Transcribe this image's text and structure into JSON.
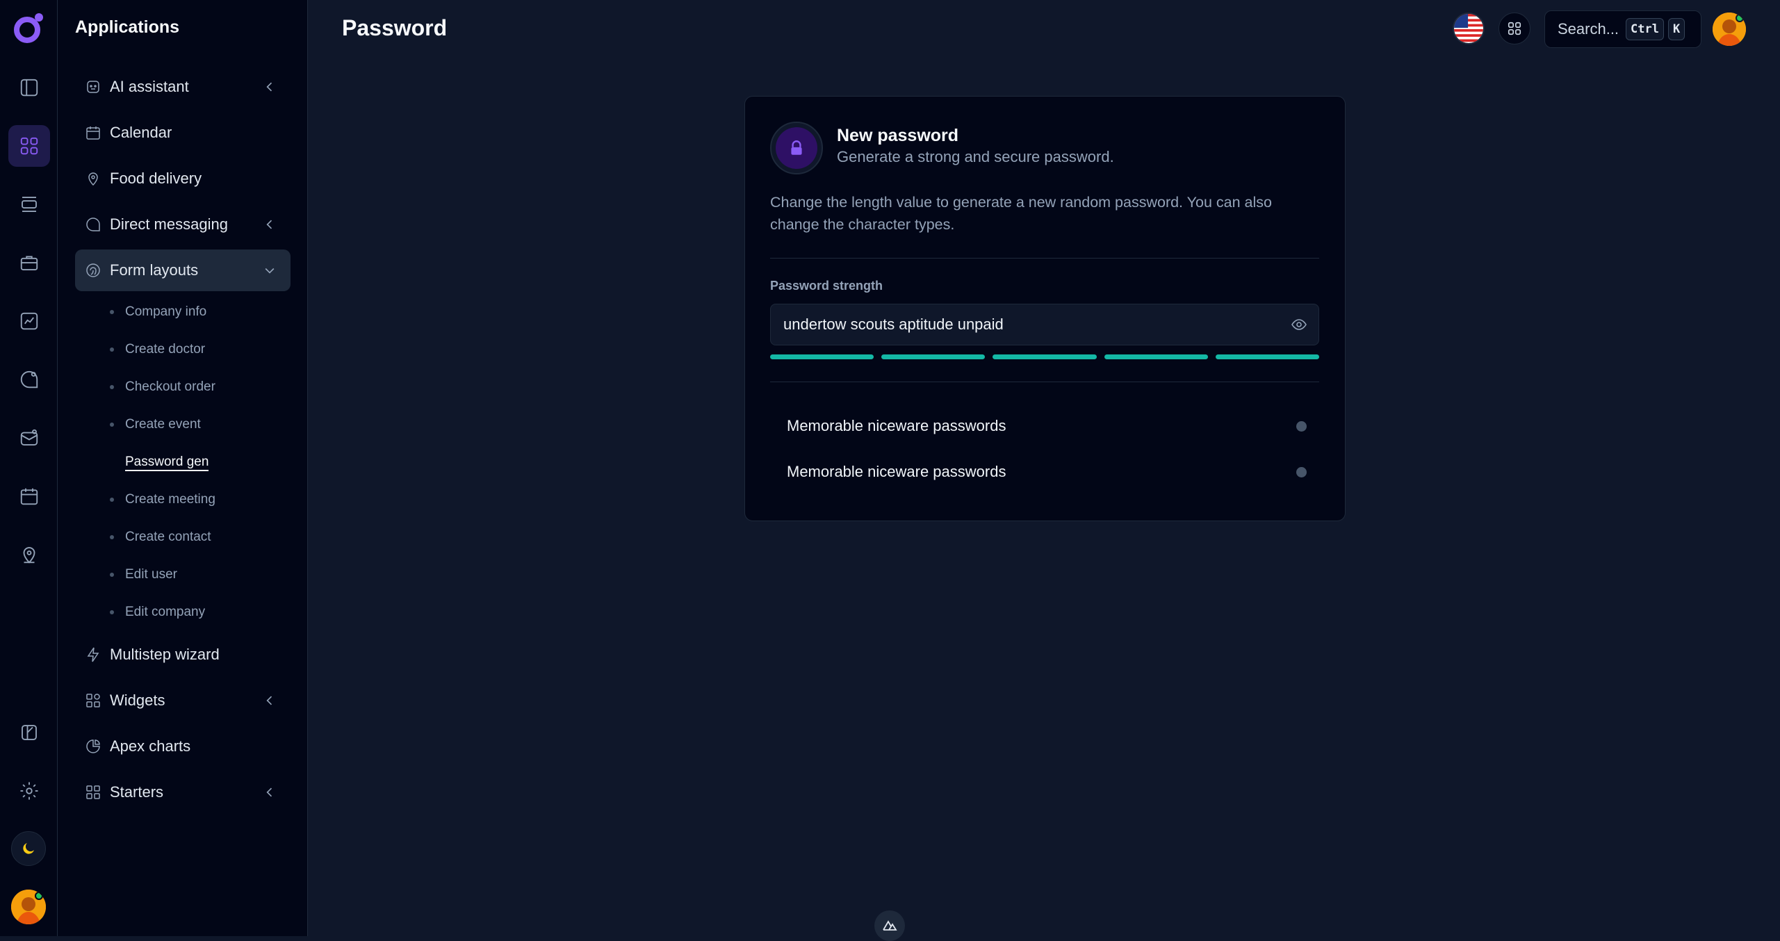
{
  "sidebar": {
    "title": "Applications",
    "items": [
      {
        "label": "AI assistant"
      },
      {
        "label": "Calendar"
      },
      {
        "label": "Food delivery"
      },
      {
        "label": "Direct messaging"
      },
      {
        "label": "Form layouts"
      },
      {
        "label": "Multistep wizard"
      },
      {
        "label": "Widgets"
      },
      {
        "label": "Apex charts"
      },
      {
        "label": "Starters"
      }
    ],
    "subitems": [
      {
        "label": "Company info"
      },
      {
        "label": "Create doctor"
      },
      {
        "label": "Checkout order"
      },
      {
        "label": "Create event"
      },
      {
        "label": "Password gen"
      },
      {
        "label": "Create meeting"
      },
      {
        "label": "Create contact"
      },
      {
        "label": "Edit user"
      },
      {
        "label": "Edit company"
      }
    ],
    "active_subitem": "Password gen"
  },
  "header": {
    "title": "Password",
    "search_placeholder": "Search...",
    "shortcut": [
      "Ctrl",
      "K"
    ],
    "language_icon": "us-flag-icon"
  },
  "card": {
    "title": "New password",
    "subtitle": "Generate a strong and secure password.",
    "description": "Change the length value to generate a new random password. You can also change the character types.",
    "field_label": "Password strength",
    "password_value": "undertow scouts aptitude unpaid",
    "strength_filled_segments": 5,
    "strength_total_segments": 5,
    "toggles": [
      {
        "label": "Memorable niceware passwords"
      },
      {
        "label": "Memorable niceware passwords"
      }
    ]
  },
  "colors": {
    "accent": "#8b5cf6",
    "strength": "#14b8a6",
    "background": "#0f172a",
    "panel": "#020617"
  }
}
